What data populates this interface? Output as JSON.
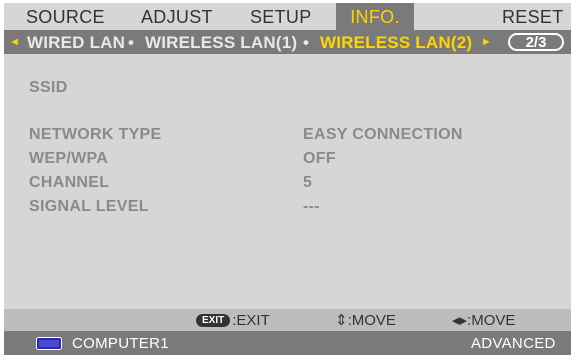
{
  "menu": {
    "tabs": [
      {
        "label": "SOURCE"
      },
      {
        "label": "ADJUST"
      },
      {
        "label": "SETUP"
      },
      {
        "label": "INFO."
      },
      {
        "label": "RESET"
      }
    ],
    "active_tab": "INFO."
  },
  "submenu": {
    "left_arrow": "◄",
    "right_arrow": "►",
    "items": [
      "WIRED LAN",
      "WIRELESS LAN(1)",
      "WIRELESS LAN(2)"
    ],
    "separator": "•",
    "active_item": "WIRELESS LAN(2)",
    "page_indicator": "2/3"
  },
  "info": {
    "ssid_label": "SSID",
    "rows": [
      {
        "label": "NETWORK TYPE",
        "value": "EASY CONNECTION"
      },
      {
        "label": "WEP/WPA",
        "value": "OFF"
      },
      {
        "label": "CHANNEL",
        "value": "5"
      },
      {
        "label": "SIGNAL LEVEL",
        "value": "---"
      }
    ]
  },
  "help": {
    "exit_key": "EXIT",
    "exit_text": ":EXIT",
    "move_ud": "⇕:MOVE",
    "move_lr": "◂▸:MOVE"
  },
  "status": {
    "source": "COMPUTER1",
    "mode": "ADVANCED"
  },
  "colors": {
    "background": "#d6d6d6",
    "bar": "#7a7a7a",
    "highlight": "#ffd400",
    "help_bar": "#bdbdbd"
  }
}
